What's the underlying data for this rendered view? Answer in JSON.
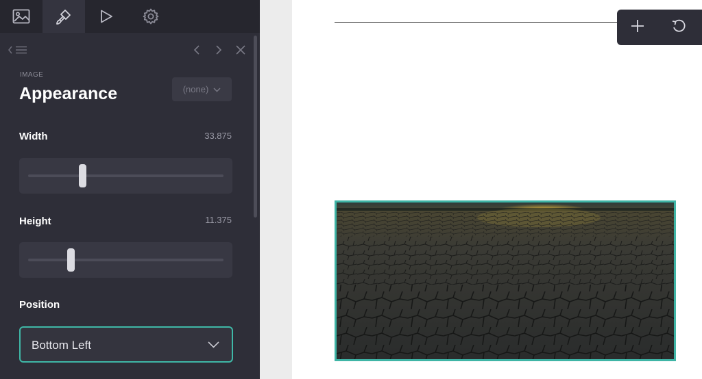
{
  "toolbar": {
    "tools": [
      {
        "icon": "image-icon",
        "active": false
      },
      {
        "icon": "paint-brush-icon",
        "active": true
      },
      {
        "icon": "play-icon",
        "active": false
      },
      {
        "icon": "gear-icon",
        "active": false
      }
    ]
  },
  "nav": {
    "back_icon": "chevron-left-list-icon",
    "prev_icon": "chevron-left-icon",
    "next_icon": "chevron-right-icon",
    "close_icon": "close-icon"
  },
  "section": {
    "kicker": "IMAGE",
    "title": "Appearance",
    "style_dropdown_value": "(none)"
  },
  "fields": {
    "width": {
      "label": "Width",
      "value": "33.875",
      "slider_fraction": 0.28
    },
    "height": {
      "label": "Height",
      "value": "11.375",
      "slider_fraction": 0.22
    },
    "position": {
      "label": "Position",
      "value": "Bottom Left"
    }
  },
  "canvas": {
    "floating_toolbar": {
      "add_icon": "plus-icon",
      "undo_icon": "undo-icon"
    },
    "image": {
      "subject": "cracked-dry-earth-sunset-photo"
    }
  },
  "colors": {
    "panel_bg": "#2e2e38",
    "toolbar_bg": "#26262e",
    "accent": "#3fb8a7",
    "canvas_bg": "#ffffff"
  }
}
